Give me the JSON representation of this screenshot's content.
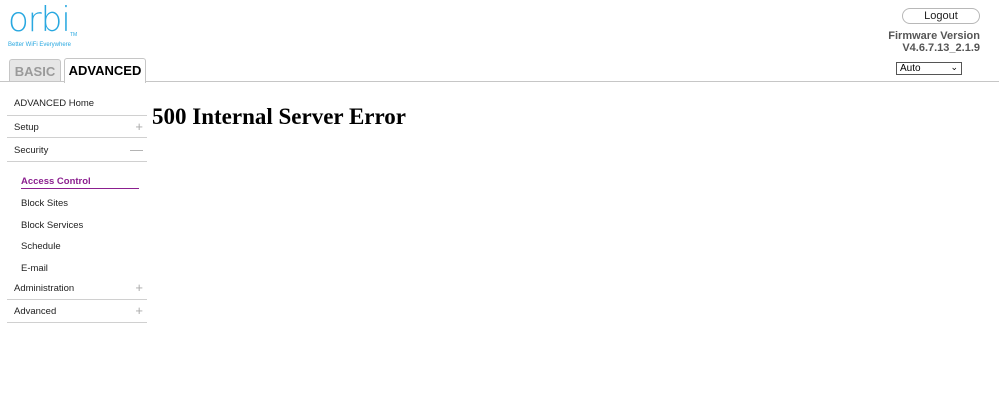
{
  "brand": {
    "logo_text": "orbi",
    "tm": "TM",
    "tagline": "Better WiFi Everywhere",
    "color": "#29a8e0"
  },
  "tabs": [
    {
      "label": "BASIC",
      "active": false
    },
    {
      "label": "ADVANCED",
      "active": true
    }
  ],
  "header": {
    "logout_label": "Logout",
    "firmware_label": "Firmware Version",
    "firmware_version": "V4.6.7.13_2.1.9",
    "language_selected": "Auto"
  },
  "sidebar": {
    "items": [
      {
        "label": "ADVANCED Home",
        "expander": ""
      },
      {
        "label": "Setup",
        "expander": "+"
      },
      {
        "label": "Security",
        "expander": "—"
      },
      {
        "label": "Administration",
        "expander": "+"
      },
      {
        "label": "Advanced",
        "expander": "+"
      }
    ],
    "security_sub": [
      {
        "label": "Access Control",
        "active": true
      },
      {
        "label": "Block Sites",
        "active": false
      },
      {
        "label": "Block Services",
        "active": false
      },
      {
        "label": "Schedule",
        "active": false
      },
      {
        "label": "E-mail",
        "active": false
      }
    ],
    "active_color": "#8b1f8f"
  },
  "main": {
    "error_title": "500 Internal Server Error"
  }
}
